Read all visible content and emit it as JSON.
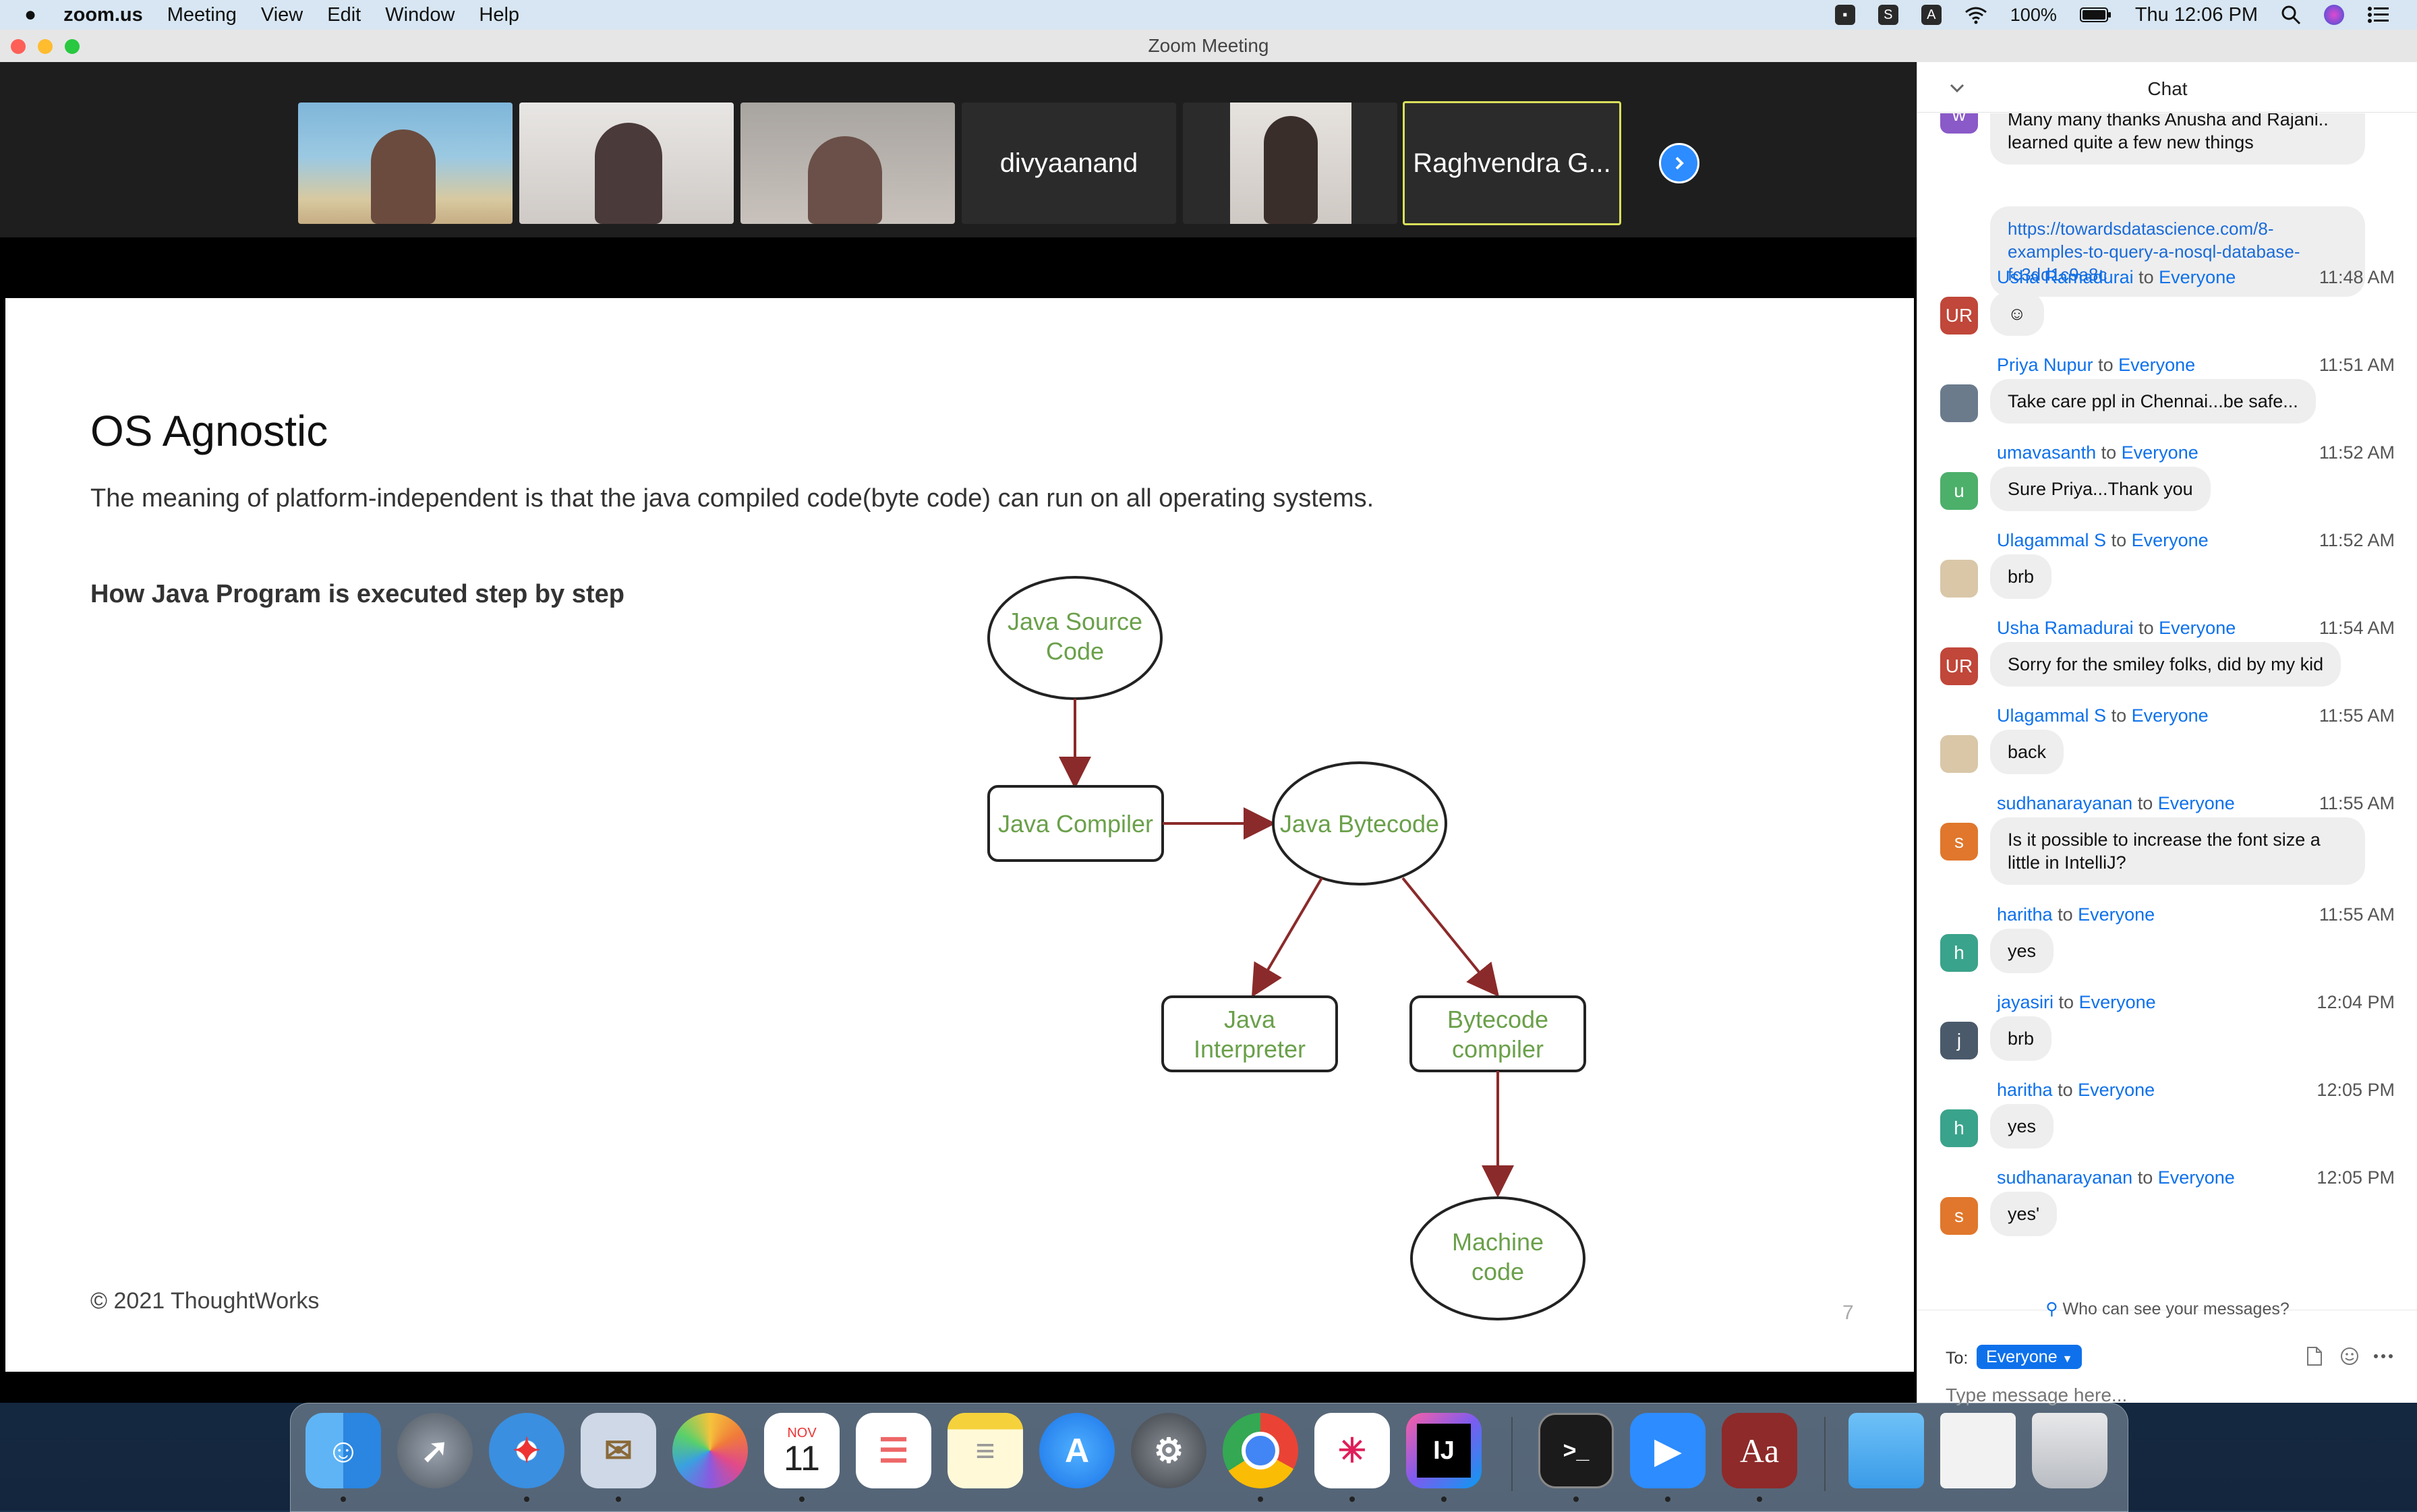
{
  "menubar": {
    "app": "zoom.us",
    "items": [
      "Meeting",
      "View",
      "Edit",
      "Window",
      "Help"
    ],
    "battery": "100%",
    "clock": "Thu 12:06 PM"
  },
  "window": {
    "title": "Zoom Meeting"
  },
  "participants": [
    {
      "name": "",
      "type": "video"
    },
    {
      "name": "",
      "type": "video"
    },
    {
      "name": "",
      "type": "video"
    },
    {
      "name": "divyaanand",
      "type": "name"
    },
    {
      "name": "",
      "type": "video"
    },
    {
      "name": "Raghvendra G...",
      "type": "name"
    }
  ],
  "slide": {
    "title": "OS Agnostic",
    "body": "The meaning of platform-independent is that the java compiled code(byte code) can run on all operating systems.",
    "subheading": "How Java Program is executed step by step",
    "footer": "© 2021 ThoughtWorks",
    "page": "7",
    "diagram": {
      "source": [
        "Java Source",
        "Code"
      ],
      "compiler": "Java Compiler",
      "bytecode": "Java Bytecode",
      "interpreter": [
        "Java",
        "Interpreter"
      ],
      "bccompiler": [
        "Bytecode",
        "compiler"
      ],
      "machine": [
        "Machine",
        "code"
      ]
    },
    "accent_color": "#6aa04a",
    "arrow_color": "#8b2a2a"
  },
  "chat": {
    "title": "Chat",
    "partial_message": [
      "Many many thanks Anusha and Rajani..",
      "learned quite a few new things"
    ],
    "link": [
      "https://towardsdatascience.com/8-",
      "examples-to-query-a-nosql-database-",
      "fc3dd1c9a8c"
    ],
    "to_word": "to",
    "messages": [
      {
        "sender": "Usha Ramadurai",
        "to": "Everyone",
        "time": "11:48 AM",
        "text": "☺",
        "avatar": "UR",
        "color": "#c0473a"
      },
      {
        "sender": "Priya Nupur",
        "to": "Everyone",
        "time": "11:51 AM",
        "text": "Take care ppl in Chennai...be safe...",
        "avatar": "",
        "color": "#6b7b8c"
      },
      {
        "sender": "umavasanth",
        "to": "Everyone",
        "time": "11:52 AM",
        "text": "Sure Priya...Thank you",
        "avatar": "u",
        "color": "#4caf6a"
      },
      {
        "sender": "Ulagammal  S",
        "to": "Everyone",
        "time": "11:52 AM",
        "text": "brb",
        "avatar": "",
        "color": "#d9c7a8"
      },
      {
        "sender": "Usha Ramadurai",
        "to": "Everyone",
        "time": "11:54 AM",
        "text": "Sorry for the smiley folks, did by my kid",
        "avatar": "UR",
        "color": "#c0473a"
      },
      {
        "sender": "Ulagammal  S",
        "to": "Everyone",
        "time": "11:55 AM",
        "text": "back",
        "avatar": "",
        "color": "#d9c7a8"
      },
      {
        "sender": "sudhanarayanan",
        "to": "Everyone",
        "time": "11:55 AM",
        "text": "Is it possible to increase the font size a little in IntelliJ?",
        "avatar": "s",
        "color": "#e0772c"
      },
      {
        "sender": "haritha",
        "to": "Everyone",
        "time": "11:55 AM",
        "text": "yes",
        "avatar": "h",
        "color": "#3aa38b"
      },
      {
        "sender": "jayasiri",
        "to": "Everyone",
        "time": "12:04 PM",
        "text": "brb",
        "avatar": "j",
        "color": "#4a5a6a"
      },
      {
        "sender": "haritha",
        "to": "Everyone",
        "time": "12:05 PM",
        "text": "yes",
        "avatar": "h",
        "color": "#3aa38b"
      },
      {
        "sender": "sudhanarayanan",
        "to": "Everyone",
        "time": "12:05 PM",
        "text": "yes'",
        "avatar": "s",
        "color": "#e0772c"
      }
    ],
    "who_can_see": "Who can see your messages?",
    "to_label": "To:",
    "recipient": "Everyone",
    "input_placeholder": "Type message here..."
  },
  "dock": {
    "calendar_month": "NOV",
    "calendar_day": "11",
    "apps": [
      "finder",
      "launchpad",
      "safari",
      "mail",
      "photos",
      "calendar",
      "reminders",
      "notes",
      "app-store",
      "system-preferences",
      "chrome",
      "slack",
      "intellij",
      "terminal",
      "zoom",
      "dictionary",
      "folder",
      "document",
      "trash"
    ],
    "intellij_label": "IJ",
    "dictionary_label": "Aa"
  }
}
